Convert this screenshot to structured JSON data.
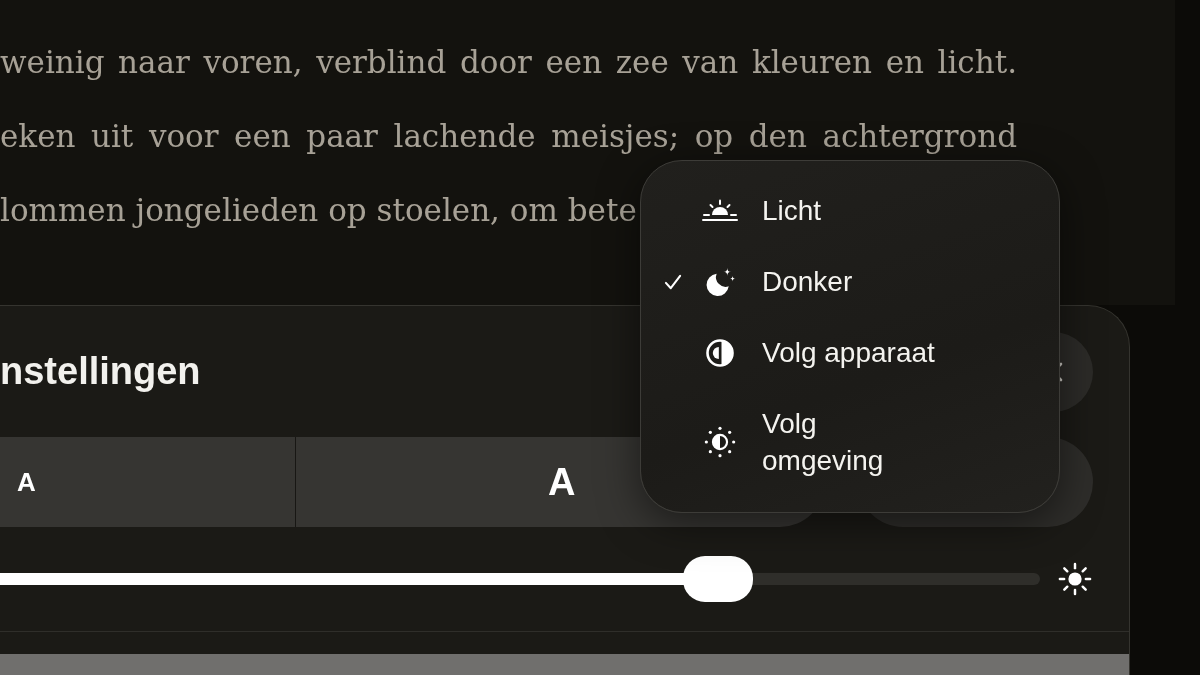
{
  "reader": {
    "lines": [
      "weinig naar voren, verblind door een zee van kleuren en licht.",
      "eken uit voor een paar lachende meisjes; op den achtergrond",
      "lommen jongelieden op stoelen, om bete"
    ]
  },
  "settings_panel": {
    "title": "nstellingen",
    "font_size_buttons": [
      {
        "label": "A",
        "kind": "small"
      },
      {
        "label": "A",
        "kind": "large"
      }
    ],
    "brightness": {
      "level": 0.69
    }
  },
  "theme_menu": {
    "items": [
      {
        "label": "Licht",
        "selected": false
      },
      {
        "label": "Donker",
        "selected": true
      },
      {
        "label": "Volg apparaat",
        "selected": false
      },
      {
        "label": "Volg omgeving",
        "selected": false
      }
    ]
  }
}
